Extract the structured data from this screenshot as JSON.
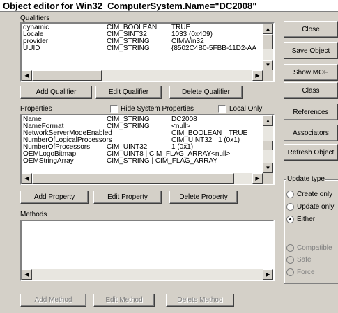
{
  "window": {
    "title": "Object editor for Win32_ComputerSystem.Name=\"DC2008\""
  },
  "qualifiers": {
    "label": "Qualifiers",
    "rows": [
      {
        "name": "dynamic",
        "type": "CIM_BOOLEAN",
        "value": "TRUE"
      },
      {
        "name": "Locale",
        "type": "CIM_SINT32",
        "value": "1033 (0x409)"
      },
      {
        "name": "provider",
        "type": "CIM_STRING",
        "value": "CIMWin32"
      },
      {
        "name": "UUID",
        "type": "CIM_STRING",
        "value": "{8502C4B0-5FBB-11D2-AA"
      }
    ],
    "buttons": {
      "add": "Add Qualifier",
      "edit": "Edit Qualifier",
      "delete": "Delete Qualifier"
    }
  },
  "properties": {
    "label": "Properties",
    "hide_system_label": "Hide System Properties",
    "local_only_label": "Local Only",
    "rows": [
      {
        "name": "Name",
        "type": "CIM_STRING",
        "value": "DC2008"
      },
      {
        "name": "NameFormat",
        "type": "CIM_STRING",
        "value": "<null>"
      },
      {
        "name": "NetworkServerModeEnabled",
        "type": "CIM_BOOLEAN",
        "value": "TRUE"
      },
      {
        "name": "NumberOfLogicalProcessors",
        "type": "CIM_UINT32",
        "value": "1 (0x1)"
      },
      {
        "name": "NumberOfProcessors",
        "type": "CIM_UINT32",
        "value": "1 (0x1)"
      },
      {
        "name": "OEMLogoBitmap",
        "type": "CIM_UINT8 | CIM_FLAG_ARRAY",
        "value": "<null>"
      },
      {
        "name": "OEMStringArray",
        "type": "CIM_STRING | CIM_FLAG_ARRAY",
        "value": ""
      }
    ],
    "buttons": {
      "add": "Add Property",
      "edit": "Edit Property",
      "delete": "Delete Property"
    }
  },
  "methods": {
    "label": "Methods",
    "buttons": {
      "add": "Add Method",
      "edit": "Edit Method",
      "delete": "Delete Method"
    }
  },
  "side_buttons": {
    "close": "Close",
    "save": "Save Object",
    "show_mof": "Show MOF",
    "class": "Class",
    "references": "References",
    "associators": "Associators",
    "refresh": "Refresh Object"
  },
  "update_type": {
    "label": "Update type",
    "options": [
      "Create only",
      "Update only",
      "Either"
    ],
    "selected": "Either",
    "mode_options": [
      "Compatible",
      "Safe",
      "Force"
    ]
  }
}
